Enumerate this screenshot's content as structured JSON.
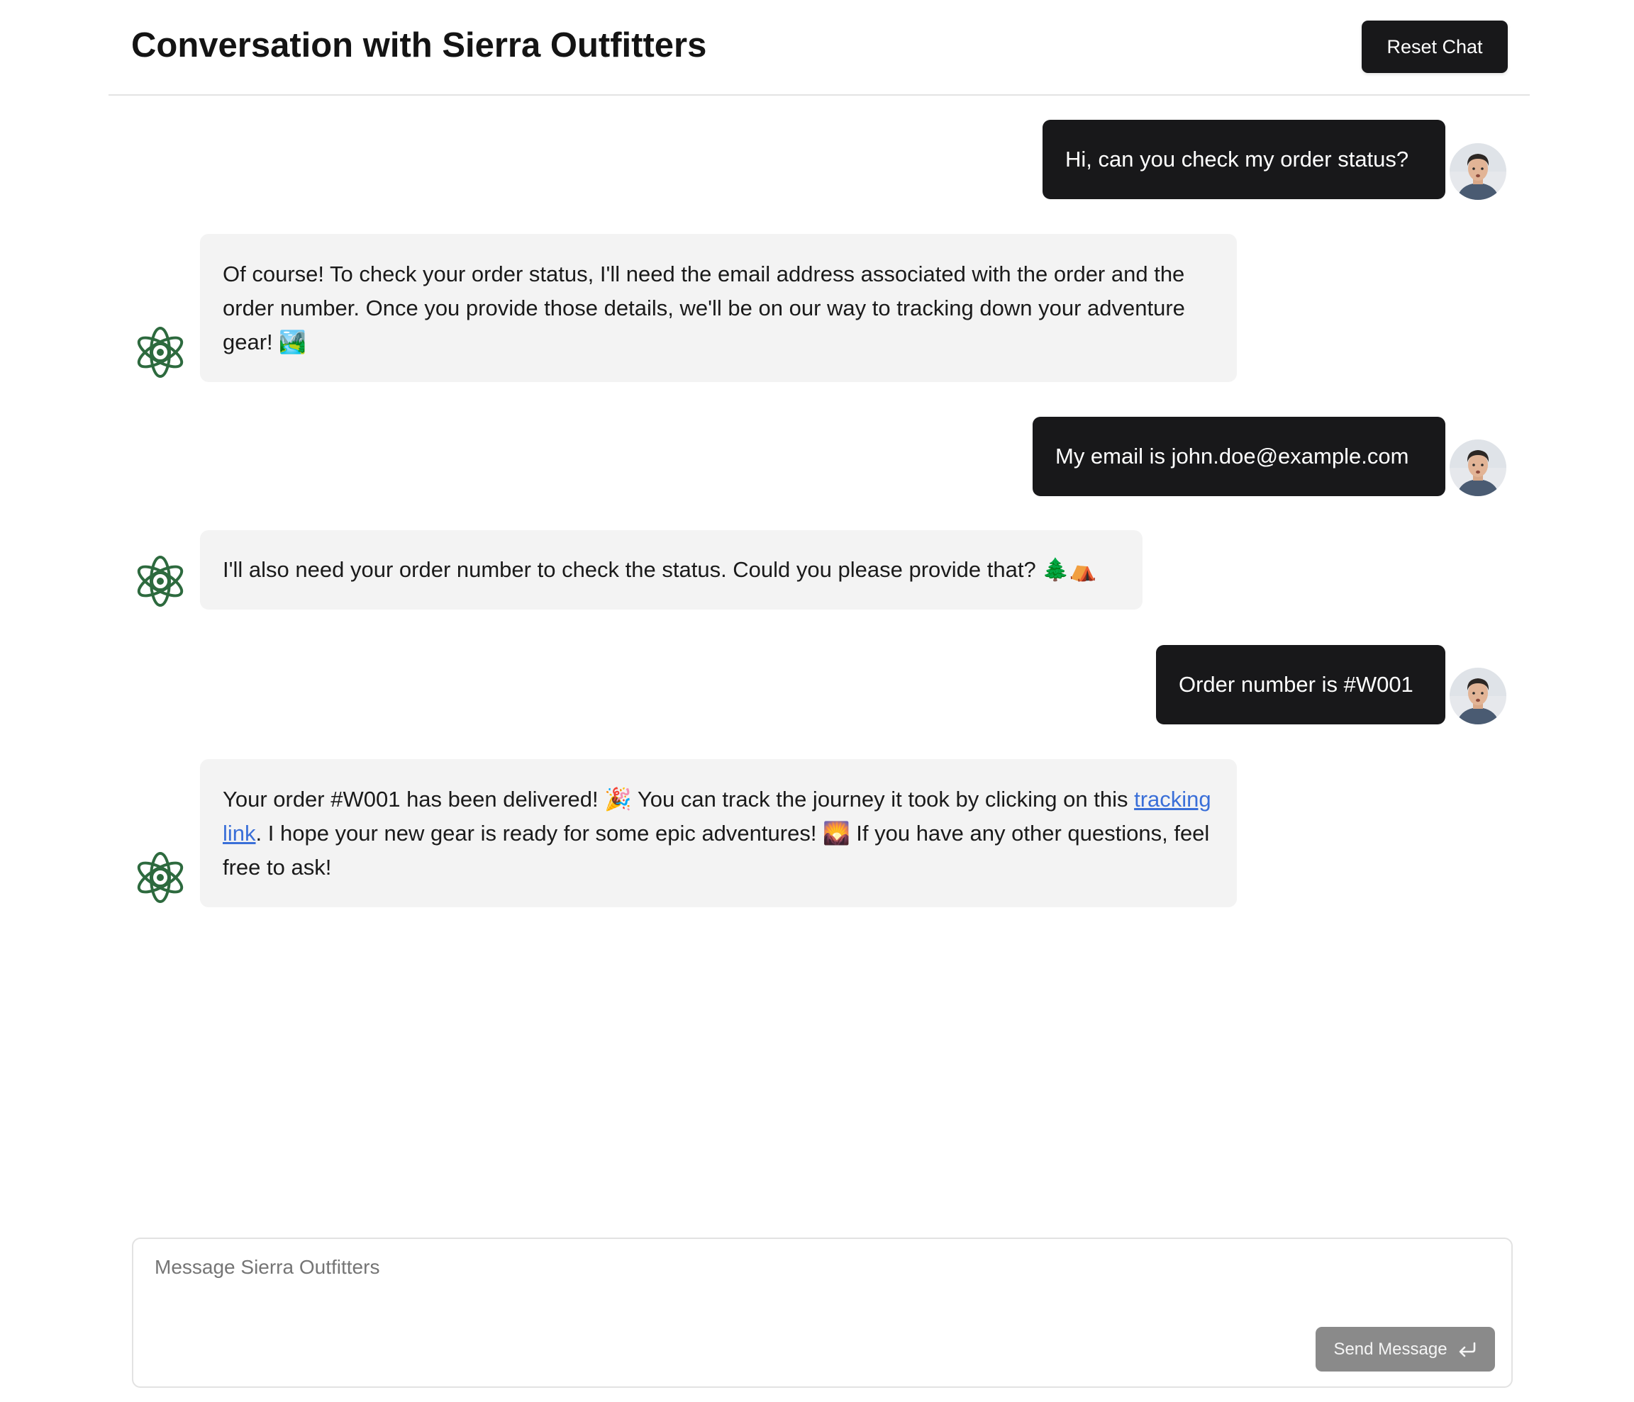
{
  "header": {
    "title": "Conversation with Sierra Outfitters",
    "reset_label": "Reset Chat"
  },
  "messages": [
    {
      "role": "user",
      "text": "Hi, can you check my order status?"
    },
    {
      "role": "assistant",
      "text": "Of course! To check your order status, I'll need the email address associated with the order and the order number. Once you provide those details, we'll be on our way to tracking down your adventure gear! 🏞️"
    },
    {
      "role": "user",
      "text": "My email is john.doe@example.com"
    },
    {
      "role": "assistant",
      "text": "I'll also need your order number to check the status. Could you please provide that? 🌲⛺"
    },
    {
      "role": "user",
      "text": "Order number is #W001"
    },
    {
      "role": "assistant",
      "text_before": "Your order #W001 has been delivered! 🎉 You can track the journey it took by clicking on this ",
      "link_text": "tracking link",
      "text_after": ". I hope your new gear is ready for some epic adventures! 🌄 If you have any other questions, feel free to ask!"
    }
  ],
  "composer": {
    "placeholder": "Message Sierra Outfitters",
    "value": "",
    "send_label": "Send Message",
    "send_icon": "enter-return-icon"
  },
  "colors": {
    "user_bubble": "#18181a",
    "assistant_bubble": "#f3f3f3",
    "brand_green": "#2d6a3e",
    "link": "#3a6fd8",
    "send_button_disabled": "#8a8a8a"
  },
  "icons": {
    "assistant_avatar": "sierra-logo-icon",
    "user_avatar": "user-avatar-photo"
  }
}
